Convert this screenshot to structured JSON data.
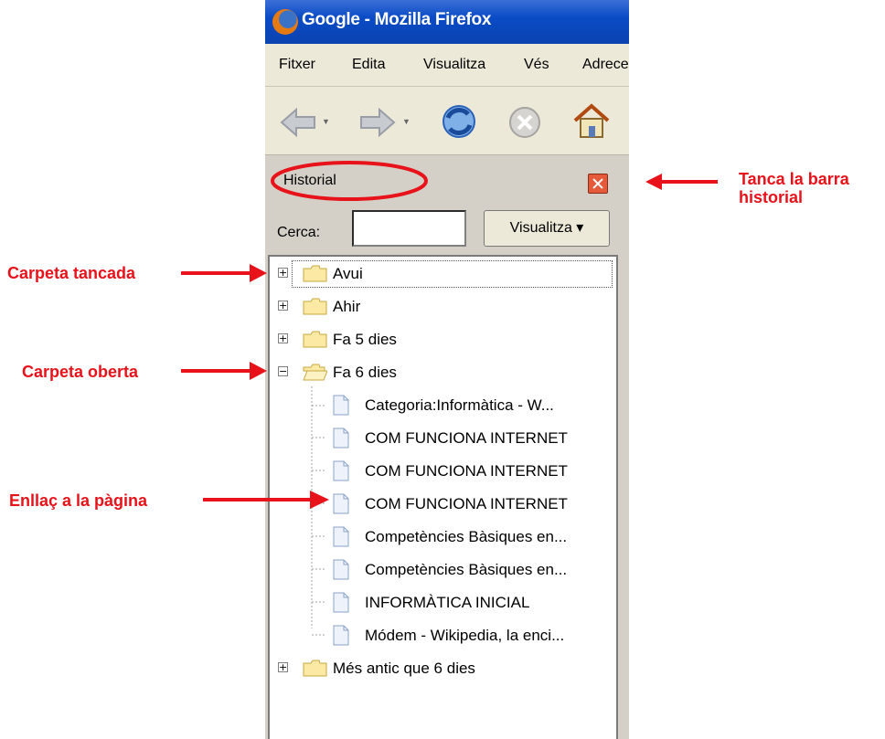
{
  "window": {
    "title": "Google - Mozilla Firefox"
  },
  "menu": [
    "Fitxer",
    "Edita",
    "Visualitza",
    "Vés",
    "Adreces"
  ],
  "sidebar": {
    "title": "Historial",
    "search_label": "Cerca:",
    "search_value": "",
    "view_button": "Visualitza ▾"
  },
  "history": {
    "folders": [
      {
        "label": "Avui",
        "state": "collapsed",
        "selected": true
      },
      {
        "label": "Ahir",
        "state": "collapsed"
      },
      {
        "label": "Fa 5 dies",
        "state": "collapsed"
      },
      {
        "label": "Fa 6 dies",
        "state": "expanded",
        "pages": [
          "Categoria:Informàtica - W...",
          "COM FUNCIONA INTERNET",
          "COM FUNCIONA INTERNET",
          "COM FUNCIONA INTERNET",
          "Competències Bàsiques en...",
          "Competències Bàsiques en...",
          "INFORMÀTICA INICIAL",
          "Módem - Wikipedia, la enci..."
        ]
      },
      {
        "label": "Més antic que 6 dies",
        "state": "collapsed"
      }
    ]
  },
  "annotations": {
    "close_sidebar": "Tanca la barra\nhistorial",
    "closed_folder": "Carpeta tancada",
    "open_folder": "Carpeta oberta",
    "page_link": "Enllaç a la pàgina"
  },
  "colors": {
    "annotation": "#e8121a",
    "titlebar": "#0a4bc6"
  }
}
